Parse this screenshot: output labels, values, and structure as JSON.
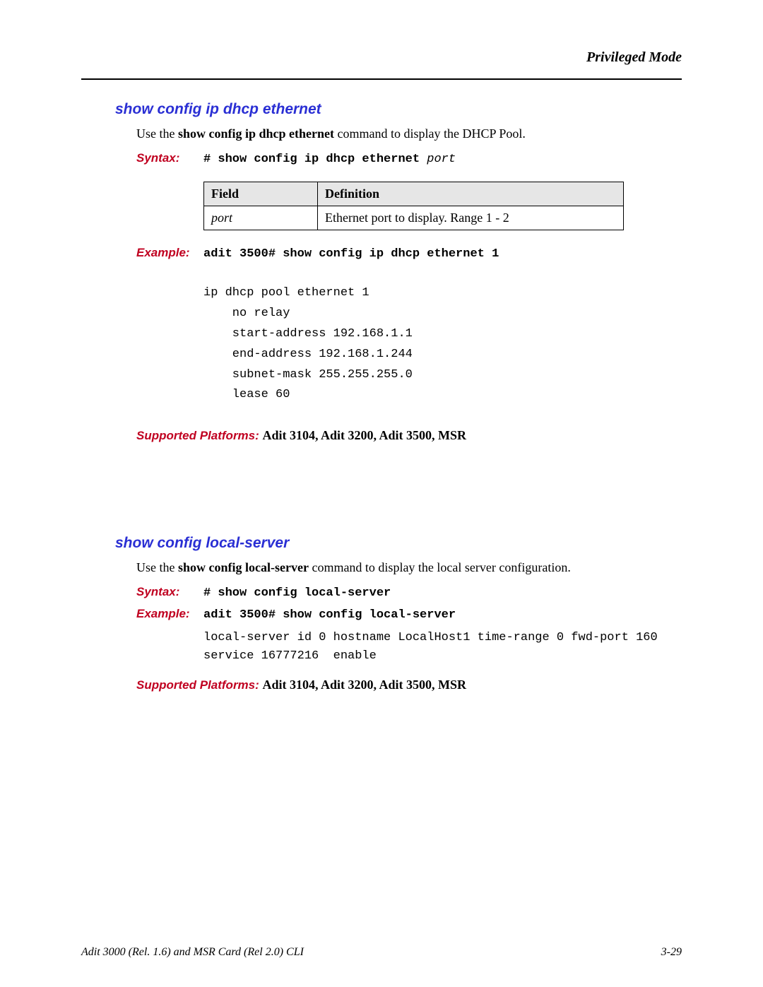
{
  "header": {
    "mode": "Privileged Mode"
  },
  "section1": {
    "title": "show config ip dhcp ethernet",
    "intro_pre": "Use the ",
    "intro_bold": "show config ip dhcp ethernet",
    "intro_post": " command to display the DHCP Pool.",
    "syntax_label": "Syntax:",
    "syntax_cmd": "# show config ip dhcp ethernet ",
    "syntax_param": "port",
    "table": {
      "h_field": "Field",
      "h_def": "Definition",
      "row_field": "port",
      "row_def": "Ethernet port to display. Range 1 - 2"
    },
    "example_label": "Example:",
    "example_cmd": "adit 3500# show config ip dhcp ethernet 1",
    "output": "ip dhcp pool ethernet 1\n    no relay\n    start-address 192.168.1.1\n    end-address 192.168.1.244\n    subnet-mask 255.255.255.0\n    lease 60",
    "platforms_label": "Supported Platforms:  ",
    "platforms_val": "Adit 3104, Adit 3200, Adit 3500, MSR"
  },
  "section2": {
    "title": "show config local-server",
    "intro_pre": "Use the ",
    "intro_bold": "show config local-server",
    "intro_post": " command to display the local server configuration.",
    "syntax_label": "Syntax:",
    "syntax_cmd": "# show config local-server",
    "example_label": "Example:",
    "example_cmd": "adit 3500# show config local-server",
    "output": "local-server id 0 hostname LocalHost1 time-range 0 fwd-port 160\nservice 16777216  enable",
    "platforms_label": "Supported Platforms:  ",
    "platforms_val": "Adit 3104, Adit 3200, Adit 3500, MSR"
  },
  "footer": {
    "left": "Adit 3000 (Rel. 1.6) and MSR Card (Rel 2.0) CLI",
    "right": "3-29"
  }
}
